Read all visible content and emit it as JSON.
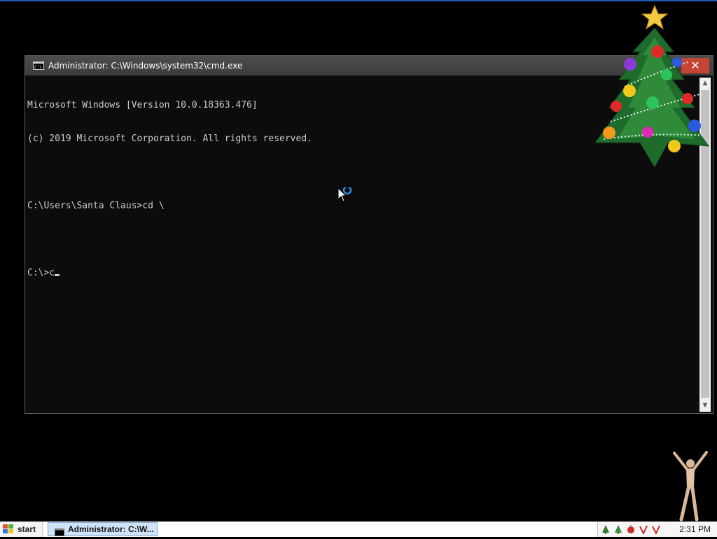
{
  "window": {
    "title": "Administrator: C:\\Windows\\system32\\cmd.exe",
    "close_label": "✕"
  },
  "console": {
    "lines": [
      "Microsoft Windows [Version 10.0.18363.476]",
      "(c) 2019 Microsoft Corporation. All rights reserved.",
      "",
      "C:\\Users\\Santa Claus>cd \\",
      "",
      "C:\\>c"
    ]
  },
  "taskbar": {
    "start_label": "start",
    "task_label": "Administrator: C:\\W...",
    "clock": "2:31 PM"
  },
  "icons": {
    "window": "cmd-icon",
    "close": "close-icon",
    "cursor": "busy-cursor-icon",
    "tray": [
      "tree-tray-icon",
      "tree-tray-icon",
      "ornament-tray-icon",
      "check-red-icon",
      "check-red-icon"
    ]
  },
  "colors": {
    "console_bg": "#0c0c0c",
    "console_text": "#cccccc",
    "close_red": "#c54635",
    "taskbar_active": "#cfe3f7"
  }
}
